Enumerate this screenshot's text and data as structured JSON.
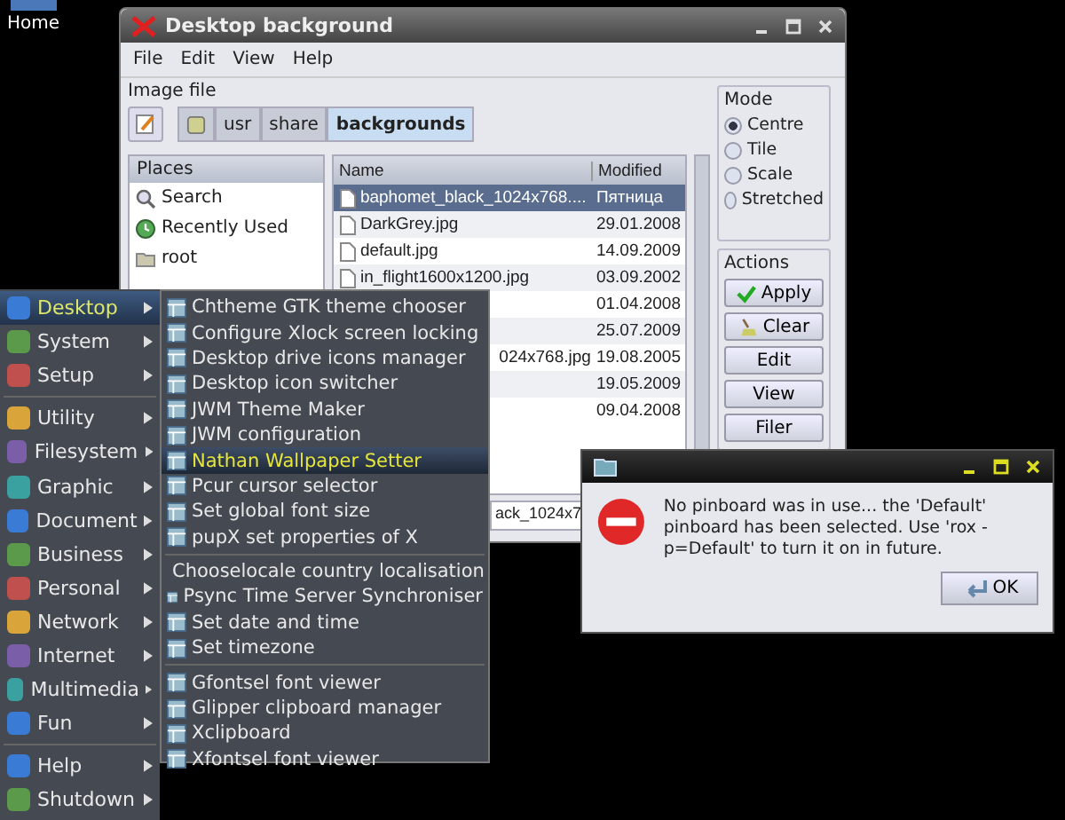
{
  "desktop_icon": {
    "label": "Home"
  },
  "window": {
    "title": "Desktop background",
    "menu": [
      "File",
      "Edit",
      "View",
      "Help"
    ],
    "image_file": {
      "label": "Image file",
      "path": [
        {
          "label": "usr",
          "selected": false
        },
        {
          "label": "share",
          "selected": false
        },
        {
          "label": "backgrounds",
          "selected": true
        }
      ]
    },
    "places": {
      "header": "Places",
      "items": [
        "Search",
        "Recently Used",
        "root"
      ]
    },
    "files": {
      "columns": [
        "Name",
        "Modified"
      ],
      "rows": [
        {
          "name": "baphomet_black_1024x768....",
          "modified": "Пятница",
          "selected": true
        },
        {
          "name": "DarkGrey.jpg",
          "modified": "29.01.2008",
          "selected": false
        },
        {
          "name": "default.jpg",
          "modified": "14.09.2009",
          "selected": false
        },
        {
          "name": "in_flight1600x1200.jpg",
          "modified": "03.09.2002",
          "selected": false
        },
        {
          "modified": "01.04.2008",
          "selected": false
        },
        {
          "modified": "25.07.2009",
          "selected": false
        },
        {
          "name": "024x768.jpg",
          "modified": "19.08.2005",
          "selected": false
        },
        {
          "modified": "19.05.2009",
          "selected": false
        },
        {
          "modified": "09.04.2008",
          "selected": false
        }
      ]
    },
    "filename_field": {
      "value": "ack_1024x7"
    },
    "mode": {
      "label": "Mode",
      "options": [
        {
          "label": "Centre",
          "selected": true
        },
        {
          "label": "Tile",
          "selected": false
        },
        {
          "label": "Scale",
          "selected": false
        },
        {
          "label": "Stretched",
          "selected": false
        }
      ]
    },
    "actions": {
      "label": "Actions",
      "buttons": [
        "Apply",
        "Clear",
        "Edit",
        "View",
        "Filer"
      ]
    }
  },
  "start_menu": {
    "sections": [
      [
        {
          "label": "Desktop",
          "selected": true
        },
        {
          "label": "System",
          "selected": false
        },
        {
          "label": "Setup",
          "selected": false
        }
      ],
      [
        {
          "label": "Utility",
          "selected": false
        },
        {
          "label": "Filesystem",
          "selected": false
        },
        {
          "label": "Graphic",
          "selected": false
        },
        {
          "label": "Document",
          "selected": false
        },
        {
          "label": "Business",
          "selected": false
        },
        {
          "label": "Personal",
          "selected": false
        },
        {
          "label": "Network",
          "selected": false
        },
        {
          "label": "Internet",
          "selected": false
        },
        {
          "label": "Multimedia",
          "selected": false
        },
        {
          "label": "Fun",
          "selected": false
        }
      ],
      [
        {
          "label": "Help",
          "selected": false
        },
        {
          "label": "Shutdown",
          "selected": false
        }
      ]
    ]
  },
  "submenu": {
    "sections": [
      [
        {
          "label": "Chtheme GTK theme chooser",
          "selected": false
        },
        {
          "label": "Configure Xlock screen locking",
          "selected": false
        },
        {
          "label": "Desktop drive icons manager",
          "selected": false
        },
        {
          "label": "Desktop icon switcher",
          "selected": false
        },
        {
          "label": "JWM Theme Maker",
          "selected": false
        },
        {
          "label": "JWM configuration",
          "selected": false
        },
        {
          "label": "Nathan Wallpaper Setter",
          "selected": true
        },
        {
          "label": "Pcur cursor selector",
          "selected": false
        },
        {
          "label": "Set global font size",
          "selected": false
        },
        {
          "label": "pupX set properties of X",
          "selected": false
        }
      ],
      [
        {
          "label": "Chooselocale country localisation",
          "selected": false
        },
        {
          "label": "Psync Time Server Synchroniser",
          "selected": false
        },
        {
          "label": "Set date and time",
          "selected": false
        },
        {
          "label": "Set timezone",
          "selected": false
        }
      ],
      [
        {
          "label": "Gfontsel font viewer",
          "selected": false
        },
        {
          "label": "Glipper clipboard manager",
          "selected": false
        },
        {
          "label": "Xclipboard",
          "selected": false
        },
        {
          "label": "Xfontsel font viewer",
          "selected": false
        }
      ]
    ]
  },
  "dialog": {
    "message": "No pinboard was in use... the 'Default' pinboard has been selected. Use 'rox -p=Default' to turn it on in future.",
    "button": "OK"
  }
}
